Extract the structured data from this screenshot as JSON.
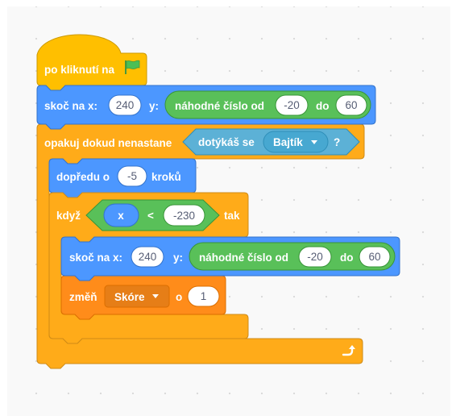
{
  "colors": {
    "events": "#ffbf00",
    "events_dark": "#cc9900",
    "motion": "#4c97ff",
    "motion_dark": "#3373cc",
    "control": "#ffab19",
    "control_dark": "#cf8b17",
    "operators": "#59c059",
    "operators_dark": "#389438",
    "sensing": "#5cb1d6",
    "sensing_dark": "#2e8eb8",
    "variables": "#ff8c1a",
    "variables_dark": "#db6e00",
    "flag": "#4cbf56"
  },
  "hat": {
    "label": "po kliknutí na",
    "icon": "green-flag-icon"
  },
  "goto1": {
    "label": "skoč na x:",
    "x": "240",
    "y_label": "y:",
    "random_label": "náhodné číslo od",
    "from": "-20",
    "to_label": "do",
    "to": "60"
  },
  "repeat_until": {
    "label": "opakuj dokud nenastane",
    "touching_label": "dotýkáš se",
    "touching_target": "Bajtík",
    "question": "?"
  },
  "move": {
    "label": "dopředu o",
    "steps": "-5",
    "suffix": "kroků"
  },
  "if_block": {
    "label": "když",
    "var": "x",
    "operator": "<",
    "value": "-230",
    "then": "tak"
  },
  "goto2": {
    "label": "skoč na x:",
    "x": "240",
    "y_label": "y:",
    "random_label": "náhodné číslo od",
    "from": "-20",
    "to_label": "do",
    "to": "60"
  },
  "change": {
    "label": "změň",
    "variable": "Skóre",
    "by_label": "o",
    "amount": "1"
  },
  "loop_icon": "loop-arrow-icon",
  "dropdown_icon": "caret-down-icon"
}
